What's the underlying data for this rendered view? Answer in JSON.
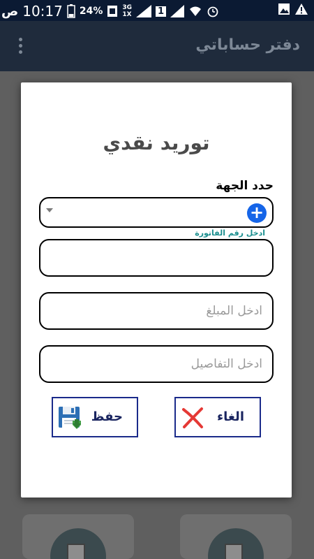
{
  "status_bar": {
    "time": "10:17",
    "ampm": "ص",
    "battery": "24%",
    "sim": "1",
    "network": "3G",
    "network2": "1X"
  },
  "app": {
    "title": "دفتر حساباتي"
  },
  "dialog": {
    "title": "توريد نقدي",
    "select_label": "حدد الجهة",
    "invoice_hint": "ادخل رقم الفاتورة",
    "invoice_value": "",
    "amount_placeholder": "ادخل المبلغ",
    "details_placeholder": "ادخل التفاصيل",
    "save_label": "حفظ",
    "cancel_label": "الغاء"
  },
  "colors": {
    "status_bar": "#0b1a33",
    "app_bar": "#1f2b3c",
    "add_button": "#1565e8",
    "hint": "#1a8e8e",
    "button_border": "#1a2a8a",
    "cancel_x": "#e53935",
    "save_icon": "#2e7d32"
  },
  "icons": {
    "add": "plus-circle-icon",
    "save": "floppy-disk-icon",
    "cancel": "red-x-icon",
    "menu": "kebab-menu-icon"
  }
}
